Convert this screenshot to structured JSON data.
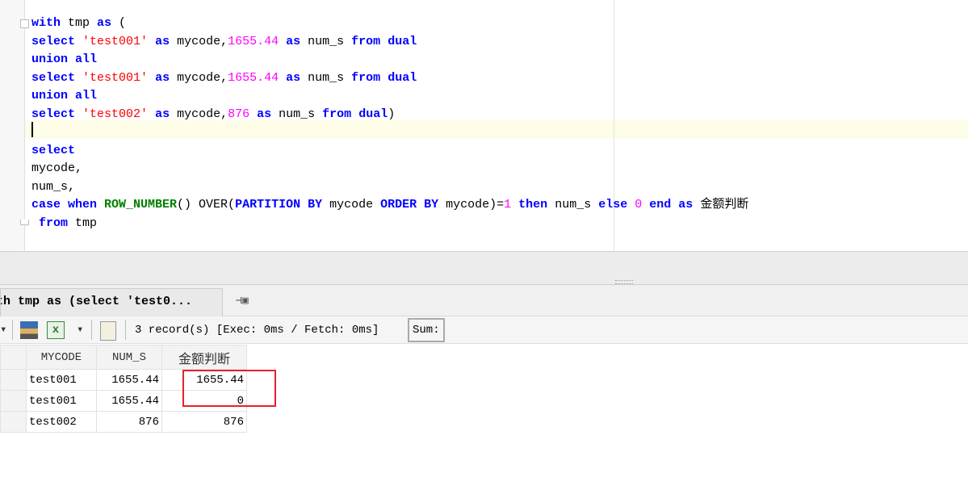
{
  "editor": {
    "lines": [
      [
        [
          "kw",
          "with"
        ],
        [
          "pl",
          " tmp "
        ],
        [
          "kw",
          "as"
        ],
        [
          "pl",
          " ("
        ]
      ],
      [
        [
          "kw",
          "select"
        ],
        [
          "pl",
          " "
        ],
        [
          "str",
          "'test001'"
        ],
        [
          "pl",
          " "
        ],
        [
          "kw",
          "as"
        ],
        [
          "pl",
          " mycode,"
        ],
        [
          "num",
          "1655.44"
        ],
        [
          "pl",
          " "
        ],
        [
          "kw",
          "as"
        ],
        [
          "pl",
          " num_s "
        ],
        [
          "kw",
          "from"
        ],
        [
          "pl",
          " "
        ],
        [
          "kw",
          "dual"
        ]
      ],
      [
        [
          "kw",
          "union all"
        ]
      ],
      [
        [
          "kw",
          "select"
        ],
        [
          "pl",
          " "
        ],
        [
          "str",
          "'test001'"
        ],
        [
          "pl",
          " "
        ],
        [
          "kw",
          "as"
        ],
        [
          "pl",
          " mycode,"
        ],
        [
          "num",
          "1655.44"
        ],
        [
          "pl",
          " "
        ],
        [
          "kw",
          "as"
        ],
        [
          "pl",
          " num_s "
        ],
        [
          "kw",
          "from"
        ],
        [
          "pl",
          " "
        ],
        [
          "kw",
          "dual"
        ]
      ],
      [
        [
          "kw",
          "union all"
        ]
      ],
      [
        [
          "kw",
          "select"
        ],
        [
          "pl",
          " "
        ],
        [
          "str",
          "'test002'"
        ],
        [
          "pl",
          " "
        ],
        [
          "kw",
          "as"
        ],
        [
          "pl",
          " mycode,"
        ],
        [
          "num",
          "876"
        ],
        [
          "pl",
          " "
        ],
        [
          "kw",
          "as"
        ],
        [
          "pl",
          " num_s "
        ],
        [
          "kw",
          "from"
        ],
        [
          "pl",
          " "
        ],
        [
          "kw",
          "dual"
        ],
        [
          "pl",
          ")"
        ]
      ],
      [],
      [
        [
          "kw",
          "select"
        ]
      ],
      [
        [
          "pl",
          "mycode,"
        ]
      ],
      [
        [
          "pl",
          "num_s,"
        ]
      ],
      [
        [
          "kw",
          "case when"
        ],
        [
          "pl",
          " "
        ],
        [
          "fn",
          "ROW_NUMBER"
        ],
        [
          "pl",
          "() OVER("
        ],
        [
          "kw",
          "PARTITION BY"
        ],
        [
          "pl",
          " mycode "
        ],
        [
          "kw",
          "ORDER BY"
        ],
        [
          "pl",
          " mycode)="
        ],
        [
          "num",
          "1"
        ],
        [
          "pl",
          " "
        ],
        [
          "kw",
          "then"
        ],
        [
          "pl",
          " num_s "
        ],
        [
          "kw",
          "else"
        ],
        [
          "pl",
          " "
        ],
        [
          "num",
          "0"
        ],
        [
          "pl",
          " "
        ],
        [
          "kw",
          "end"
        ],
        [
          "pl",
          " "
        ],
        [
          "kw",
          "as"
        ],
        [
          "pl",
          " 金额判断"
        ]
      ],
      [
        [
          "pl",
          " "
        ],
        [
          "kw",
          "from"
        ],
        [
          "pl",
          " tmp"
        ]
      ]
    ]
  },
  "result": {
    "tab_label": "th tmp as (select 'test0...",
    "status": "3 record(s) [Exec: 0ms / Fetch: 0ms]",
    "sum_label": "Sum:",
    "columns": [
      "MYCODE",
      "NUM_S",
      "金额判断"
    ],
    "rows": [
      [
        "test001",
        "1655.44",
        "1655.44"
      ],
      [
        "test001",
        "1655.44",
        "0"
      ],
      [
        "test002",
        "876",
        "876"
      ]
    ]
  },
  "colors": {
    "keyword": "#0000ff",
    "string": "#ff0000",
    "number": "#ff00ff",
    "function": "#008000",
    "highlight": "#e8202a"
  }
}
